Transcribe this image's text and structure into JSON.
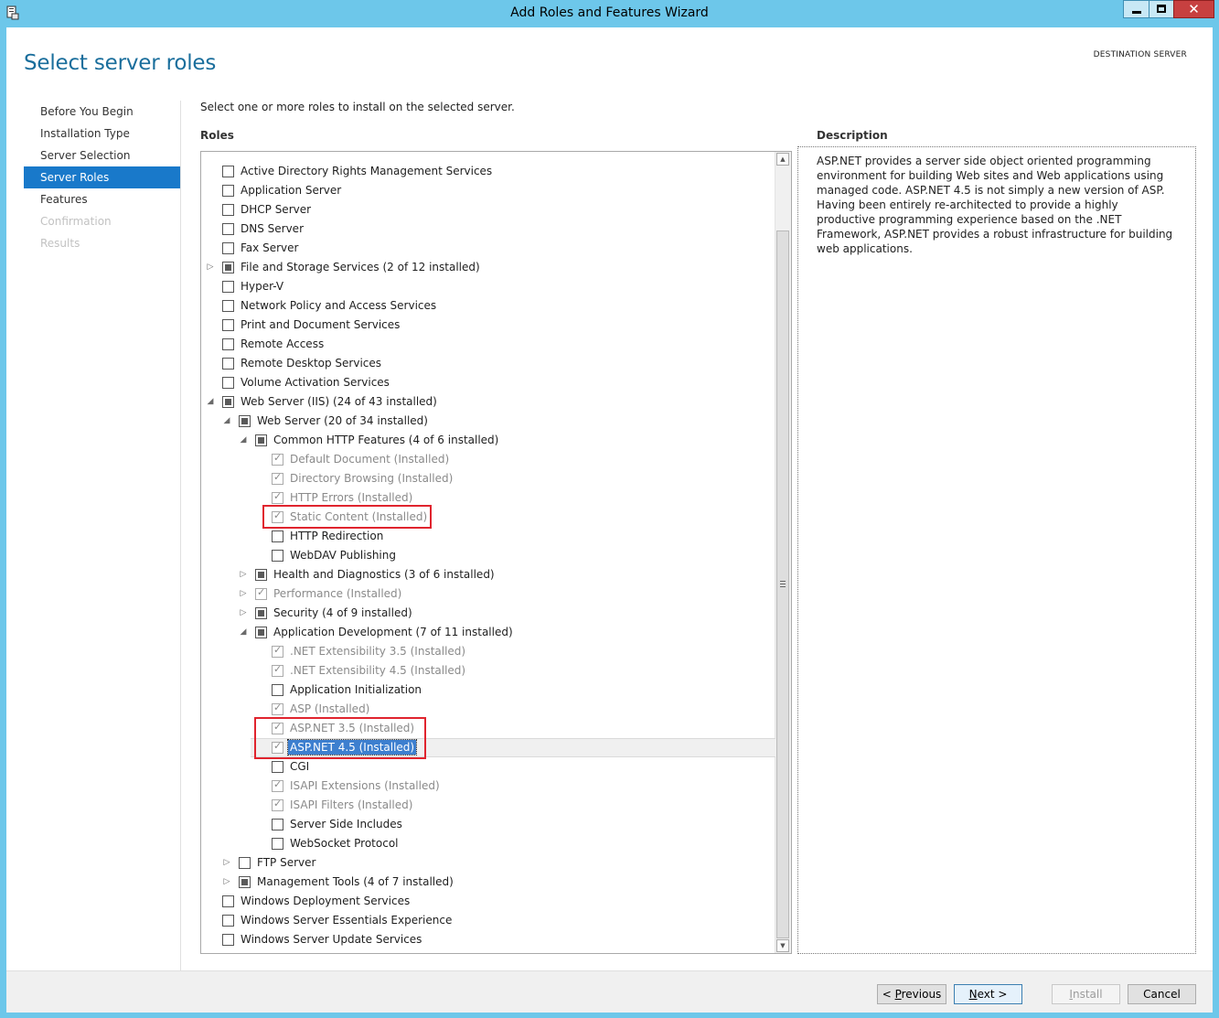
{
  "window": {
    "title": "Add Roles and Features Wizard"
  },
  "page": {
    "title": "Select server roles",
    "destination_label": "DESTINATION SERVER"
  },
  "nav": [
    {
      "label": "Before You Begin",
      "state": "normal"
    },
    {
      "label": "Installation Type",
      "state": "normal"
    },
    {
      "label": "Server Selection",
      "state": "normal"
    },
    {
      "label": "Server Roles",
      "state": "active"
    },
    {
      "label": "Features",
      "state": "normal"
    },
    {
      "label": "Confirmation",
      "state": "disabled"
    },
    {
      "label": "Results",
      "state": "disabled"
    }
  ],
  "instruction": "Select one or more roles to install on the selected server.",
  "roles_header": "Roles",
  "description_header": "Description",
  "description_text": "ASP.NET provides a server side object oriented programming environment for building Web sites and Web applications using managed code. ASP.NET 4.5 is not simply a new version of ASP. Having been entirely re-architected to provide a highly productive programming experience based on the .NET Framework, ASP.NET provides a robust infrastructure for building web applications.",
  "roles": [
    {
      "label": "Active Directory Rights Management Services",
      "level": 0,
      "check": "none",
      "expander": ""
    },
    {
      "label": "Application Server",
      "level": 0,
      "check": "none",
      "expander": ""
    },
    {
      "label": "DHCP Server",
      "level": 0,
      "check": "none",
      "expander": ""
    },
    {
      "label": "DNS Server",
      "level": 0,
      "check": "none",
      "expander": ""
    },
    {
      "label": "Fax Server",
      "level": 0,
      "check": "none",
      "expander": ""
    },
    {
      "label": "File and Storage Services (2 of 12 installed)",
      "level": 0,
      "check": "partial",
      "expander": "collapsed"
    },
    {
      "label": "Hyper-V",
      "level": 0,
      "check": "none",
      "expander": ""
    },
    {
      "label": "Network Policy and Access Services",
      "level": 0,
      "check": "none",
      "expander": ""
    },
    {
      "label": "Print and Document Services",
      "level": 0,
      "check": "none",
      "expander": ""
    },
    {
      "label": "Remote Access",
      "level": 0,
      "check": "none",
      "expander": ""
    },
    {
      "label": "Remote Desktop Services",
      "level": 0,
      "check": "none",
      "expander": ""
    },
    {
      "label": "Volume Activation Services",
      "level": 0,
      "check": "none",
      "expander": ""
    },
    {
      "label": "Web Server (IIS) (24 of 43 installed)",
      "level": 0,
      "check": "partial",
      "expander": "expanded"
    },
    {
      "label": "Web Server (20 of 34 installed)",
      "level": 1,
      "check": "partial",
      "expander": "expanded"
    },
    {
      "label": "Common HTTP Features (4 of 6 installed)",
      "level": 2,
      "check": "partial",
      "expander": "expanded"
    },
    {
      "label": "Default Document (Installed)",
      "level": 3,
      "check": "checked",
      "expander": ""
    },
    {
      "label": "Directory Browsing (Installed)",
      "level": 3,
      "check": "checked",
      "expander": ""
    },
    {
      "label": "HTTP Errors (Installed)",
      "level": 3,
      "check": "checked",
      "expander": ""
    },
    {
      "label": "Static Content (Installed)",
      "level": 3,
      "check": "checked",
      "expander": ""
    },
    {
      "label": "HTTP Redirection",
      "level": 3,
      "check": "none",
      "expander": ""
    },
    {
      "label": "WebDAV Publishing",
      "level": 3,
      "check": "none",
      "expander": ""
    },
    {
      "label": "Health and Diagnostics (3 of 6 installed)",
      "level": 2,
      "check": "partial",
      "expander": "collapsed"
    },
    {
      "label": "Performance (Installed)",
      "level": 2,
      "check": "checked",
      "expander": "collapsed"
    },
    {
      "label": "Security (4 of 9 installed)",
      "level": 2,
      "check": "partial",
      "expander": "collapsed"
    },
    {
      "label": "Application Development (7 of 11 installed)",
      "level": 2,
      "check": "partial",
      "expander": "expanded"
    },
    {
      "label": ".NET Extensibility 3.5 (Installed)",
      "level": 3,
      "check": "checked",
      "expander": ""
    },
    {
      "label": ".NET Extensibility 4.5 (Installed)",
      "level": 3,
      "check": "checked",
      "expander": ""
    },
    {
      "label": "Application Initialization",
      "level": 3,
      "check": "none",
      "expander": ""
    },
    {
      "label": "ASP (Installed)",
      "level": 3,
      "check": "checked",
      "expander": ""
    },
    {
      "label": "ASP.NET 3.5 (Installed)",
      "level": 3,
      "check": "checked",
      "expander": ""
    },
    {
      "label": "ASP.NET 4.5 (Installed)",
      "level": 3,
      "check": "checked",
      "expander": "",
      "selected": true
    },
    {
      "label": "CGI",
      "level": 3,
      "check": "none",
      "expander": ""
    },
    {
      "label": "ISAPI Extensions (Installed)",
      "level": 3,
      "check": "checked",
      "expander": ""
    },
    {
      "label": "ISAPI Filters (Installed)",
      "level": 3,
      "check": "checked",
      "expander": ""
    },
    {
      "label": "Server Side Includes",
      "level": 3,
      "check": "none",
      "expander": ""
    },
    {
      "label": "WebSocket Protocol",
      "level": 3,
      "check": "none",
      "expander": ""
    },
    {
      "label": "FTP Server",
      "level": 1,
      "check": "none",
      "expander": "collapsed"
    },
    {
      "label": "Management Tools (4 of 7 installed)",
      "level": 1,
      "check": "partial",
      "expander": "collapsed"
    },
    {
      "label": "Windows Deployment Services",
      "level": 0,
      "check": "none",
      "expander": ""
    },
    {
      "label": "Windows Server Essentials Experience",
      "level": 0,
      "check": "none",
      "expander": ""
    },
    {
      "label": "Windows Server Update Services",
      "level": 0,
      "check": "none",
      "expander": ""
    }
  ],
  "buttons": {
    "previous": {
      "prefix": "< ",
      "key": "P",
      "rest": "revious"
    },
    "next": {
      "key": "N",
      "rest": "ext >"
    },
    "install": {
      "key": "I",
      "rest": "nstall"
    },
    "cancel": "Cancel"
  },
  "colors": {
    "accent": "#1979ca",
    "title_blue": "#1a6e9c",
    "highlight_box": "#e0242e"
  }
}
